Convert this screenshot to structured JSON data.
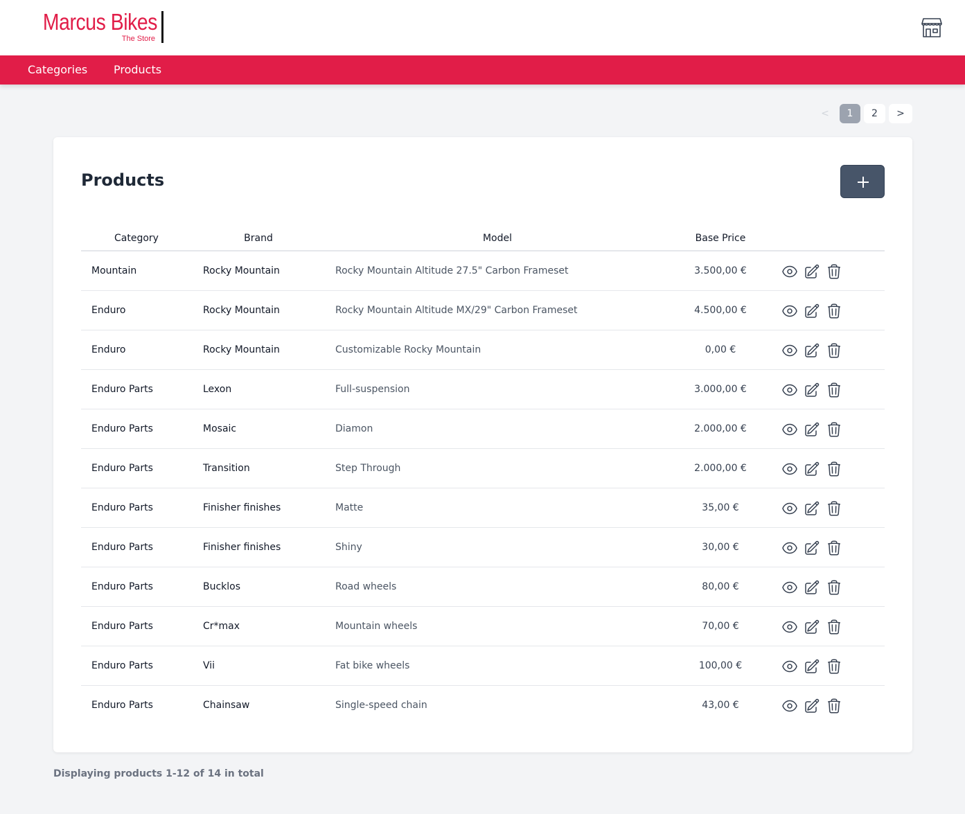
{
  "header": {
    "logo_brand": "Marcus Bikes",
    "logo_sub": "The Store",
    "store_icon": "store-icon"
  },
  "nav": {
    "items": [
      {
        "label": "Categories"
      },
      {
        "label": "Products"
      }
    ]
  },
  "pagination": {
    "prev": "<",
    "pages": [
      "1",
      "2"
    ],
    "next": ">",
    "current": "1"
  },
  "main": {
    "title": "Products",
    "add_icon": "plus-icon",
    "columns": [
      "Category",
      "Brand",
      "Model",
      "Base Price"
    ],
    "rows": [
      {
        "category": "Mountain",
        "brand": "Rocky Mountain",
        "model": "Rocky Mountain Altitude 27.5\" Carbon Frameset",
        "price": "3.500,00 €"
      },
      {
        "category": "Enduro",
        "brand": "Rocky Mountain",
        "model": "Rocky Mountain Altitude MX/29\" Carbon Frameset",
        "price": "4.500,00 €"
      },
      {
        "category": "Enduro",
        "brand": "Rocky Mountain",
        "model": "Customizable Rocky Mountain",
        "price": "0,00 €"
      },
      {
        "category": "Enduro Parts",
        "brand": "Lexon",
        "model": "Full-suspension",
        "price": "3.000,00 €"
      },
      {
        "category": "Enduro Parts",
        "brand": "Mosaic",
        "model": "Diamon",
        "price": "2.000,00 €"
      },
      {
        "category": "Enduro Parts",
        "brand": "Transition",
        "model": "Step Through",
        "price": "2.000,00 €"
      },
      {
        "category": "Enduro Parts",
        "brand": "Finisher finishes",
        "model": "Matte",
        "price": "35,00 €"
      },
      {
        "category": "Enduro Parts",
        "brand": "Finisher finishes",
        "model": "Shiny",
        "price": "30,00 €"
      },
      {
        "category": "Enduro Parts",
        "brand": "Bucklos",
        "model": "Road wheels",
        "price": "80,00 €"
      },
      {
        "category": "Enduro Parts",
        "brand": "Cr*max",
        "model": "Mountain wheels",
        "price": "70,00 €"
      },
      {
        "category": "Enduro Parts",
        "brand": "Vii",
        "model": "Fat bike wheels",
        "price": "100,00 €"
      },
      {
        "category": "Enduro Parts",
        "brand": "Chainsaw",
        "model": "Single-speed chain",
        "price": "43,00 €"
      }
    ],
    "row_action_icons": [
      "eye-icon",
      "pencil-square-icon",
      "trash-icon"
    ]
  },
  "footer": {
    "summary": "Displaying products 1-12 of 14 in total"
  },
  "colors": {
    "brand": "#e11d48",
    "button": "#475569",
    "background": "#f3f4f6"
  }
}
